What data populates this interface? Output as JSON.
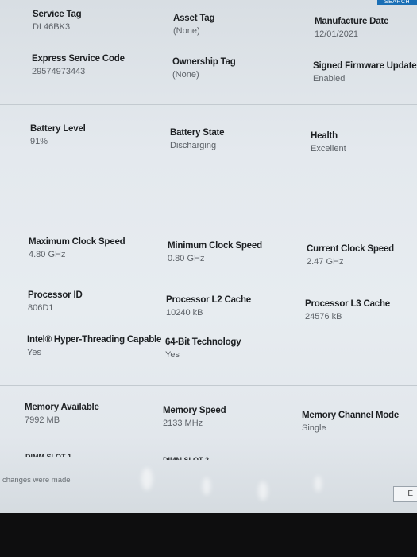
{
  "header": {
    "search_label": "SEARCH"
  },
  "system": {
    "service_tag": {
      "label": "Service Tag",
      "value": "DL46BK3"
    },
    "asset_tag": {
      "label": "Asset Tag",
      "value": "(None)"
    },
    "manufacture_date": {
      "label": "Manufacture Date",
      "value": "12/01/2021"
    },
    "express_service_code": {
      "label": "Express Service Code",
      "value": "29574973443"
    },
    "ownership_tag": {
      "label": "Ownership Tag",
      "value": "(None)"
    },
    "signed_firmware_update": {
      "label": "Signed Firmware Update",
      "value": "Enabled"
    }
  },
  "battery": {
    "level": {
      "label": "Battery Level",
      "value": "91%"
    },
    "state": {
      "label": "Battery State",
      "value": "Discharging"
    },
    "health": {
      "label": "Health",
      "value": "Excellent"
    }
  },
  "processor": {
    "max_clock": {
      "label": "Maximum Clock Speed",
      "value": "4.80 GHz"
    },
    "min_clock": {
      "label": "Minimum Clock Speed",
      "value": "0.80 GHz"
    },
    "current_clock": {
      "label": "Current Clock Speed",
      "value": "2.47 GHz"
    },
    "id": {
      "label": "Processor ID",
      "value": "806D1"
    },
    "l2_cache": {
      "label": "Processor L2 Cache",
      "value": "10240 kB"
    },
    "l3_cache": {
      "label": "Processor L3 Cache",
      "value": "24576 kB"
    },
    "hyper_threading": {
      "label": "Intel® Hyper-Threading Capable",
      "value": "Yes"
    },
    "bit64": {
      "label": "64-Bit Technology",
      "value": "Yes"
    }
  },
  "memory": {
    "available": {
      "label": "Memory Available",
      "value": "7992 MB"
    },
    "speed": {
      "label": "Memory Speed",
      "value": "2133 MHz"
    },
    "channel_mode": {
      "label": "Memory Channel Mode",
      "value": "Single"
    },
    "dimm_slot_1": "DIMM SLOT 1",
    "dimm_slot_2": "DIMM SLOT 2"
  },
  "footer": {
    "changes_text": "changes were made",
    "button_label": "E"
  }
}
